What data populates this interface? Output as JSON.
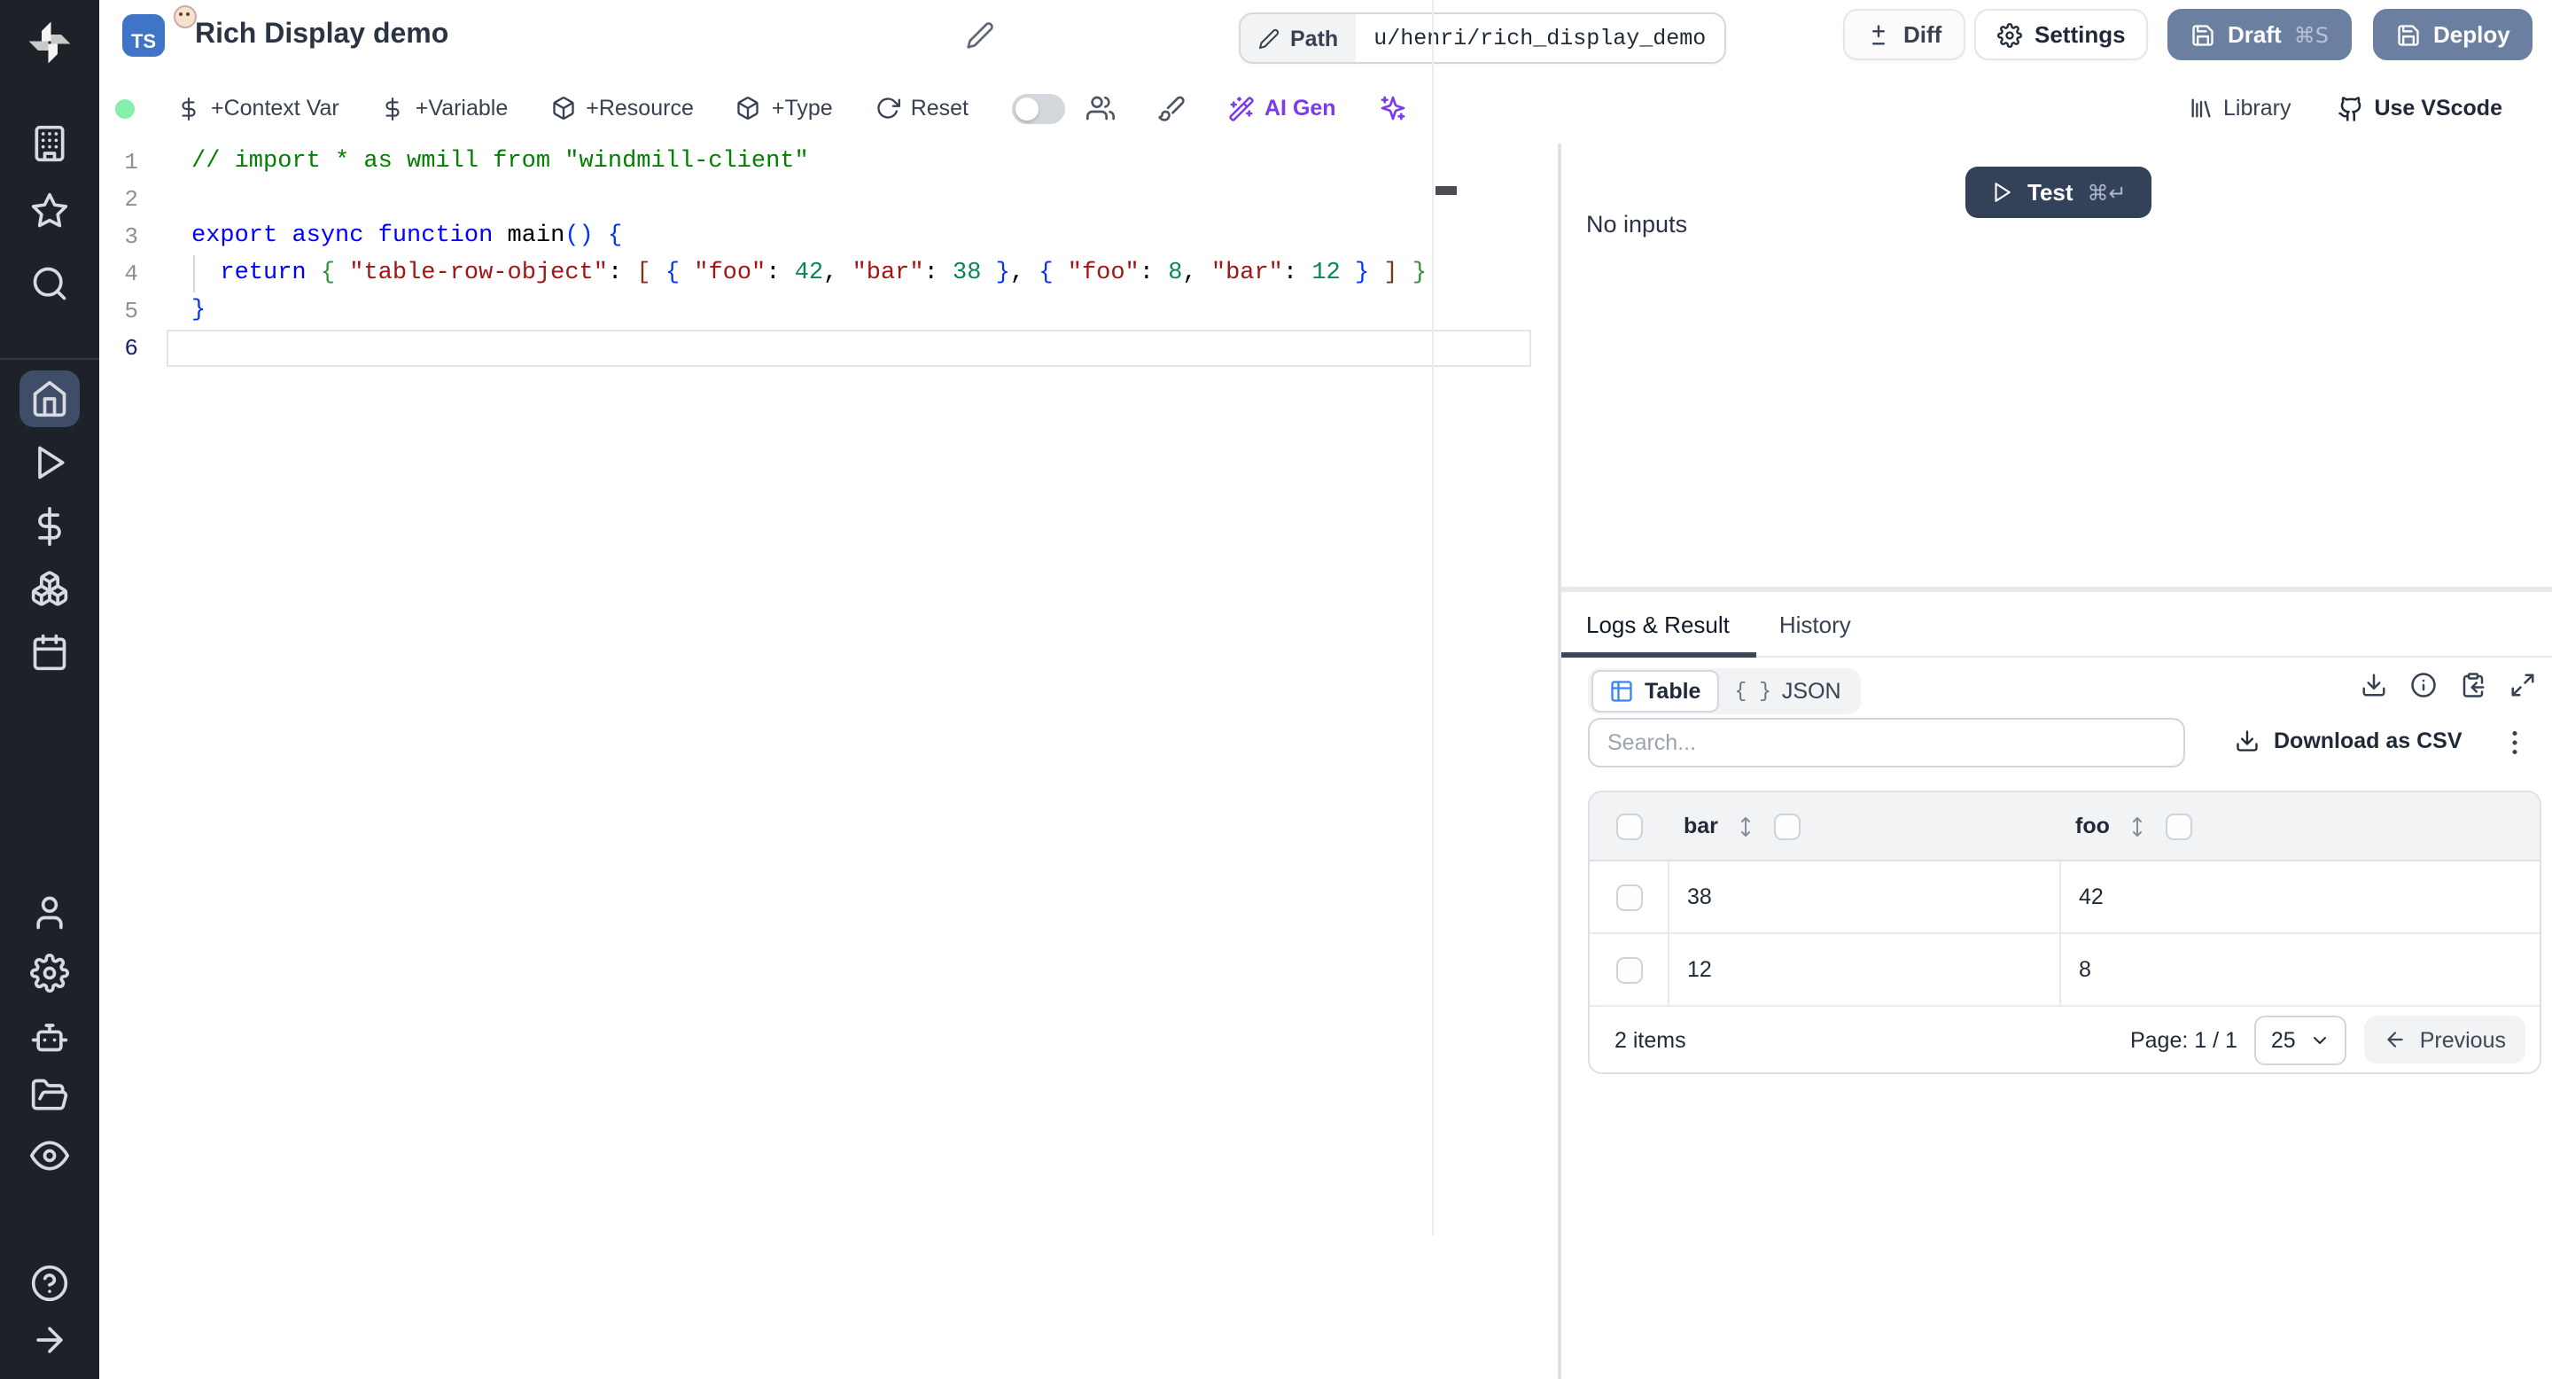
{
  "header": {
    "title": "Rich Display demo",
    "language_badge": "TS",
    "path_label": "Path",
    "path_value": "u/henri/rich_display_demo",
    "diff_label": "Diff",
    "settings_label": "Settings",
    "draft_label": "Draft",
    "draft_kbd": "⌘S",
    "deploy_label": "Deploy"
  },
  "toolbar": {
    "context_var": "+Context Var",
    "variable": "+Variable",
    "resource": "+Resource",
    "type": "+Type",
    "reset": "Reset",
    "ai_gen": "AI Gen",
    "library": "Library",
    "use_vscode": "Use VScode"
  },
  "sidebar": {
    "logo": "windmill-logo",
    "top_items": [
      "workspace",
      "favorites",
      "search"
    ],
    "nav_items": [
      "home",
      "runs",
      "variables",
      "resources",
      "schedules"
    ],
    "active_item": "home",
    "bottom_items": [
      "user",
      "settings",
      "workers",
      "folders",
      "audit-logs",
      "help",
      "expand"
    ]
  },
  "editor": {
    "active_line": 6,
    "token_colors": {
      "comment": "#008000",
      "kw": "#0000ff",
      "fn": "#000000",
      "str": "#a31515",
      "num": "#098658",
      "p": "#000000",
      "b1": "#0431fa",
      "b2": "#319331",
      "b3": "#7b3814"
    },
    "lines": [
      [
        [
          "// import * as wmill from \"windmill-client\"",
          "comment"
        ]
      ],
      [],
      [
        [
          "export ",
          "kw"
        ],
        [
          "async ",
          "kw"
        ],
        [
          "function ",
          "kw"
        ],
        [
          "main",
          "fn"
        ],
        [
          "(",
          "b1"
        ],
        [
          ")",
          "b1"
        ],
        [
          " ",
          "p"
        ],
        [
          "{",
          "b1"
        ]
      ],
      [
        [
          "  ",
          "p"
        ],
        [
          "return",
          "kw"
        ],
        [
          " ",
          "p"
        ],
        [
          "{",
          "b2"
        ],
        [
          " ",
          "p"
        ],
        [
          "\"table-row-object\"",
          "str"
        ],
        [
          ":",
          "p"
        ],
        [
          " ",
          "p"
        ],
        [
          "[",
          "b3"
        ],
        [
          " ",
          "p"
        ],
        [
          "{",
          "b1"
        ],
        [
          " ",
          "p"
        ],
        [
          "\"foo\"",
          "str"
        ],
        [
          ":",
          "p"
        ],
        [
          " ",
          "p"
        ],
        [
          "42",
          "num"
        ],
        [
          ",",
          "p"
        ],
        [
          " ",
          "p"
        ],
        [
          "\"bar\"",
          "str"
        ],
        [
          ":",
          "p"
        ],
        [
          " ",
          "p"
        ],
        [
          "38",
          "num"
        ],
        [
          " ",
          "p"
        ],
        [
          "}",
          "b1"
        ],
        [
          ",",
          "p"
        ],
        [
          " ",
          "p"
        ],
        [
          "{",
          "b1"
        ],
        [
          " ",
          "p"
        ],
        [
          "\"foo\"",
          "str"
        ],
        [
          ":",
          "p"
        ],
        [
          " ",
          "p"
        ],
        [
          "8",
          "num"
        ],
        [
          ",",
          "p"
        ],
        [
          " ",
          "p"
        ],
        [
          "\"bar\"",
          "str"
        ],
        [
          ":",
          "p"
        ],
        [
          " ",
          "p"
        ],
        [
          "12",
          "num"
        ],
        [
          " ",
          "p"
        ],
        [
          "}",
          "b1"
        ],
        [
          " ",
          "p"
        ],
        [
          "]",
          "b3"
        ],
        [
          " ",
          "p"
        ],
        [
          "}",
          "b2"
        ]
      ],
      [
        [
          "}",
          "b1"
        ]
      ],
      []
    ]
  },
  "run": {
    "test_label": "Test",
    "test_kbd": "⌘↵",
    "no_inputs": "No inputs"
  },
  "result": {
    "tab_logs": "Logs & Result",
    "tab_history": "History",
    "view_table": "Table",
    "view_json": "JSON",
    "json_glyph": "{ }",
    "search_placeholder": "Search...",
    "download_csv": "Download as CSV",
    "table": {
      "columns": [
        {
          "label": "bar"
        },
        {
          "label": "foo"
        }
      ],
      "rows": [
        [
          "38",
          "42"
        ],
        [
          "12",
          "8"
        ]
      ]
    },
    "footer": {
      "items": "2 items",
      "page": "Page: 1 / 1",
      "page_size": "25",
      "previous": "Previous"
    }
  },
  "colors": {
    "sidebar_bg": "#1d2128",
    "sidebar_active_bg": "#3f4d68",
    "primary_button": "#6b80a1",
    "test_button": "#334159",
    "ai_accent": "#7c3aed",
    "table_view_icon": "#3b82f6",
    "status_dot": "#86efac",
    "ts_badge": "#3f74c7"
  }
}
